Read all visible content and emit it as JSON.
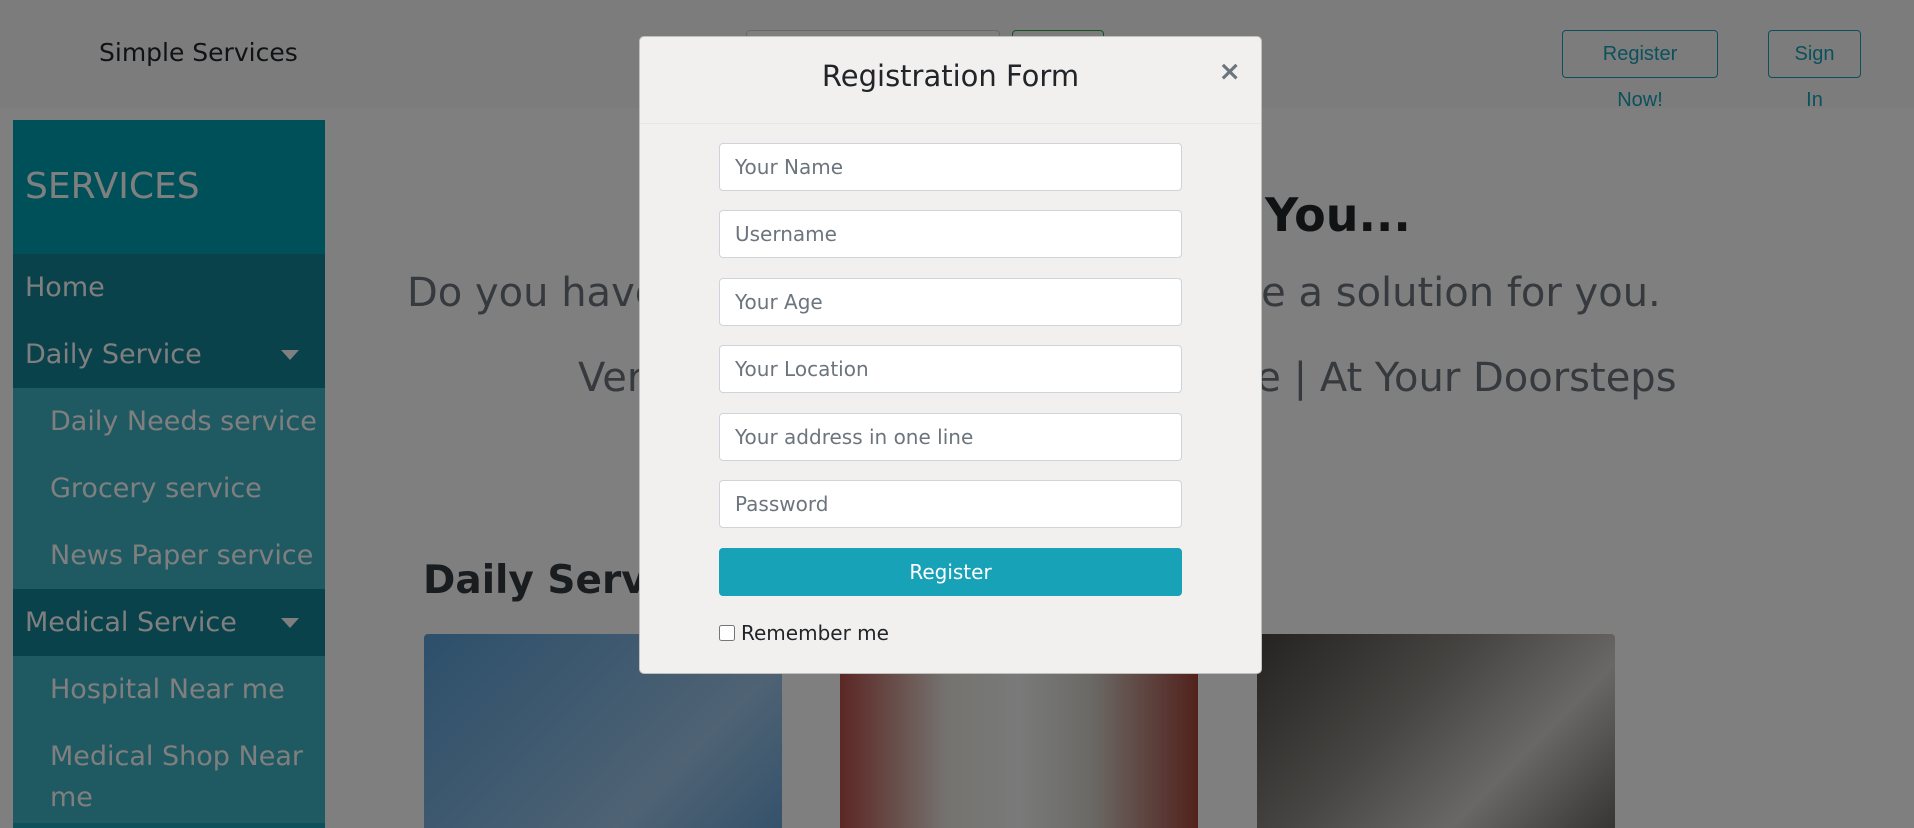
{
  "navbar": {
    "brand": "Simple Services",
    "register_label": "Register Now!",
    "signin_label": "Sign In"
  },
  "sidebar": {
    "header": "SERVICES",
    "items": [
      {
        "label": "Home",
        "type": "main"
      },
      {
        "label": "Daily Service",
        "type": "main",
        "dropdown": true
      },
      {
        "label": "Daily Needs service",
        "type": "sub"
      },
      {
        "label": "Grocery service",
        "type": "sub"
      },
      {
        "label": "News Paper service",
        "type": "sub"
      },
      {
        "label": "Medical Service",
        "type": "main",
        "dropdown": true
      },
      {
        "label": "Hospital Near me",
        "type": "sub"
      },
      {
        "label": "Medical Shop Near me",
        "type": "sub"
      }
    ]
  },
  "main": {
    "hero_title_visible": "You...",
    "hero_line1_left": "Do you have",
    "hero_line1_right": "on, we have a solution for you.",
    "hero_line2_left": "Ver",
    "hero_line2_right": "ce | At Your Doorsteps",
    "section_title": "Daily Servic"
  },
  "modal": {
    "title": "Registration Form",
    "close_symbol": "×",
    "fields": [
      {
        "placeholder": "Your Name"
      },
      {
        "placeholder": "Username"
      },
      {
        "placeholder": "Your Age"
      },
      {
        "placeholder": "Your Location"
      },
      {
        "placeholder": "Your address in one line"
      },
      {
        "placeholder": "Password"
      }
    ],
    "register_label": "Register",
    "remember_label": "Remember me"
  },
  "colors": {
    "accent": "#17a2b8",
    "sidebar_header": "#00a0b5",
    "sidebar_main": "#138496",
    "sidebar_sub": "#3fb3c4"
  }
}
